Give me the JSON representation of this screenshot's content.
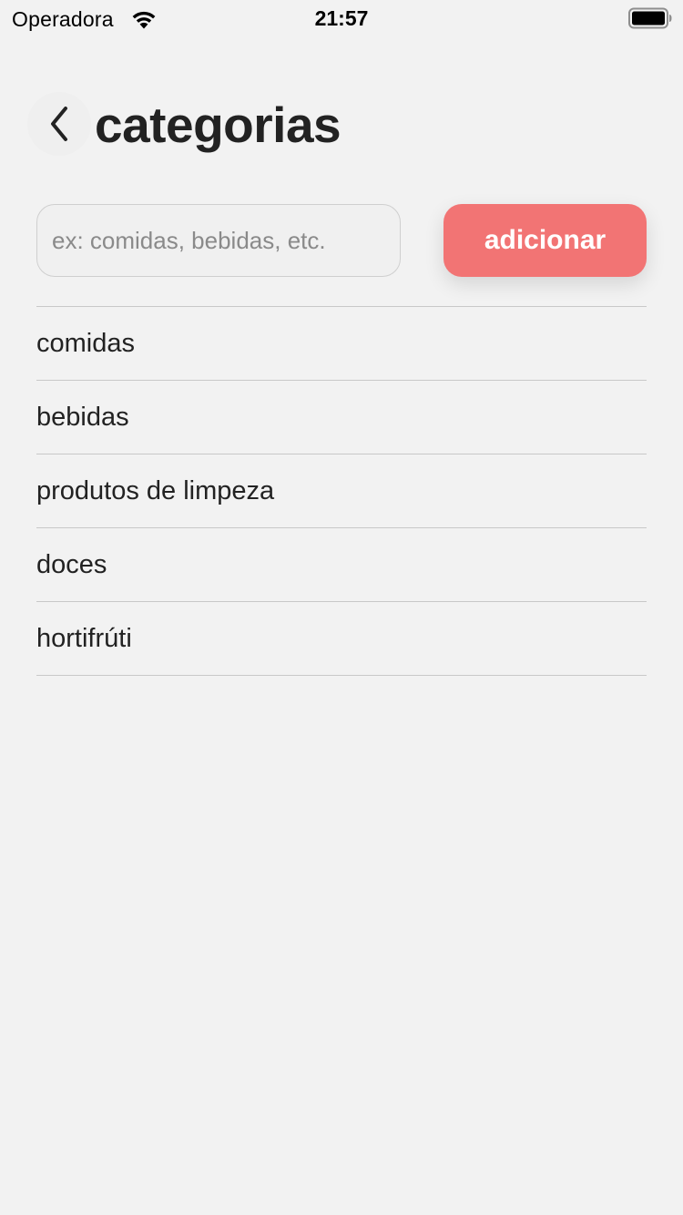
{
  "status_bar": {
    "carrier": "Operadora",
    "time": "21:57",
    "wifi_icon": "wifi-icon",
    "battery_icon": "battery-icon"
  },
  "header": {
    "back_icon": "chevron-left-icon",
    "title": "categorias"
  },
  "form": {
    "input_placeholder": "ex: comidas, bebidas, etc.",
    "input_value": "",
    "add_label": "adicionar"
  },
  "categories": [
    {
      "label": "comidas"
    },
    {
      "label": "bebidas"
    },
    {
      "label": "produtos de limpeza"
    },
    {
      "label": "doces"
    },
    {
      "label": "hortifrúti"
    }
  ],
  "colors": {
    "background": "#f2f2f2",
    "accent": "#f27474",
    "text": "#222222",
    "divider": "#c8c8c8"
  }
}
